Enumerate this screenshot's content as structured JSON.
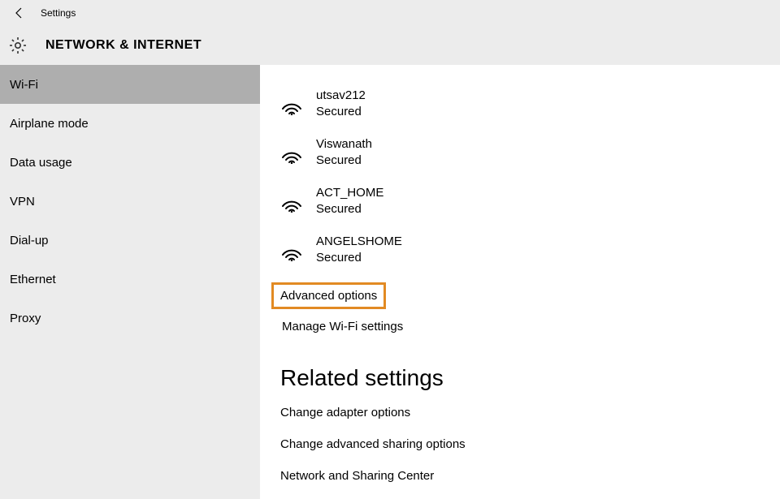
{
  "header": {
    "title": "Settings",
    "section": "NETWORK & INTERNET"
  },
  "sidebar": {
    "items": [
      {
        "label": "Wi-Fi",
        "active": true
      },
      {
        "label": "Airplane mode",
        "active": false
      },
      {
        "label": "Data usage",
        "active": false
      },
      {
        "label": "VPN",
        "active": false
      },
      {
        "label": "Dial-up",
        "active": false
      },
      {
        "label": "Ethernet",
        "active": false
      },
      {
        "label": "Proxy",
        "active": false
      }
    ]
  },
  "wifi": {
    "networks": [
      {
        "name": "utsav212",
        "status": "Secured"
      },
      {
        "name": "Viswanath",
        "status": "Secured"
      },
      {
        "name": "ACT_HOME",
        "status": "Secured"
      },
      {
        "name": "ANGELSHOME",
        "status": "Secured"
      }
    ]
  },
  "links": {
    "advanced": "Advanced options",
    "manage": "Manage Wi-Fi settings"
  },
  "related": {
    "heading": "Related settings",
    "items": [
      "Change adapter options",
      "Change advanced sharing options",
      "Network and Sharing Center"
    ]
  },
  "colors": {
    "highlight": "#e28a23"
  }
}
